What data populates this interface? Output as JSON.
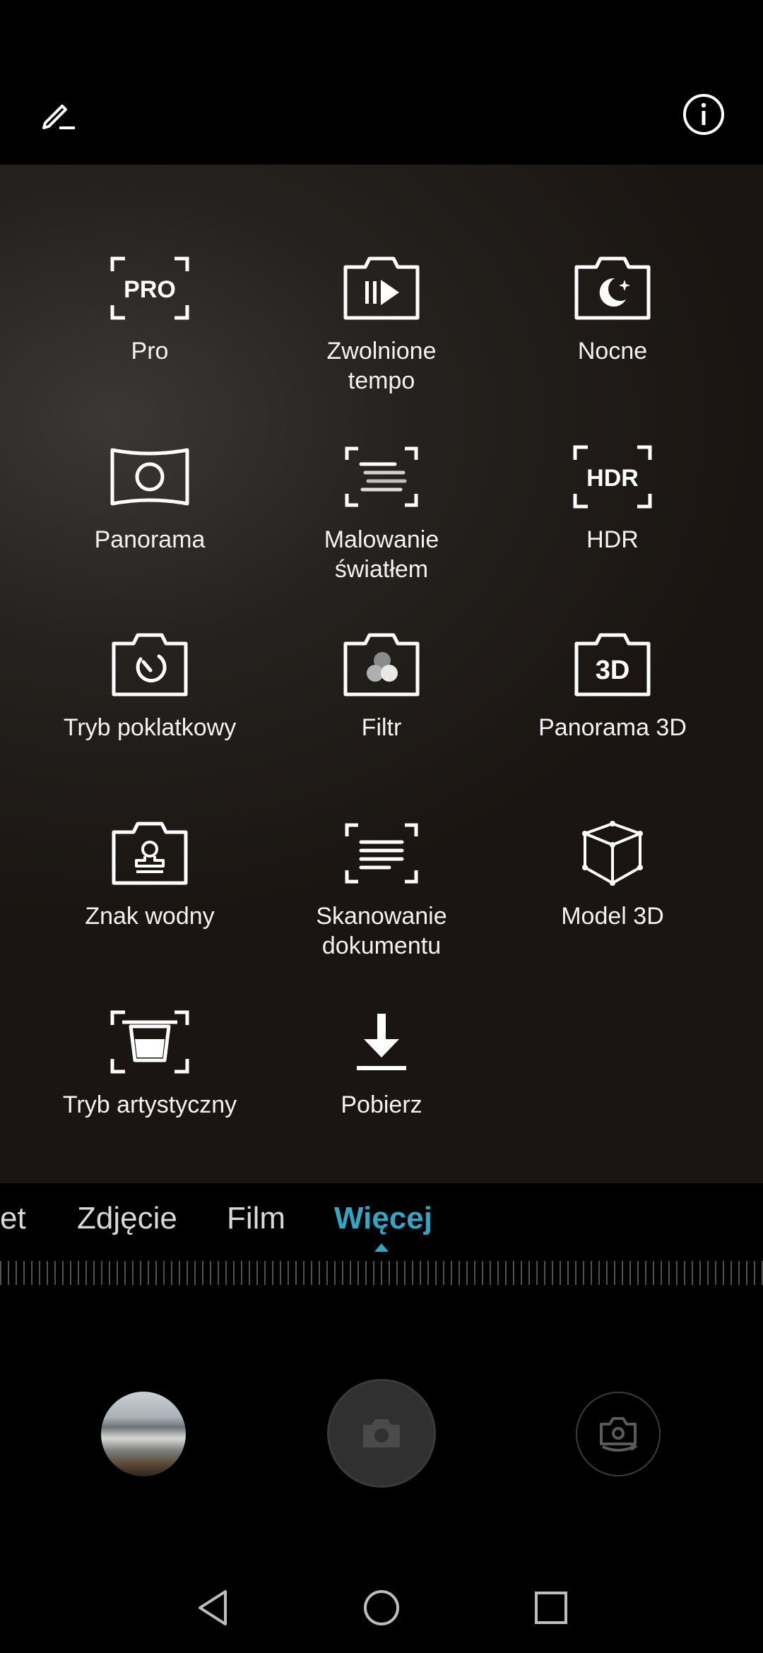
{
  "topbar": {
    "edit_icon": "pencil-edit-icon",
    "info_icon": "info-icon"
  },
  "modes": [
    {
      "label": "Pro",
      "icon": "pro-icon"
    },
    {
      "label": "Zwolnione\ntempo",
      "icon": "slow-motion-icon"
    },
    {
      "label": "Nocne",
      "icon": "night-icon"
    },
    {
      "label": "Panorama",
      "icon": "panorama-icon"
    },
    {
      "label": "Malowanie\nświatłem",
      "icon": "light-painting-icon"
    },
    {
      "label": "HDR",
      "icon": "hdr-icon"
    },
    {
      "label": "Tryb poklatkowy",
      "icon": "time-lapse-icon"
    },
    {
      "label": "Filtr",
      "icon": "filter-icon"
    },
    {
      "label": "Panorama 3D",
      "icon": "panorama-3d-icon"
    },
    {
      "label": "Znak wodny",
      "icon": "watermark-icon"
    },
    {
      "label": "Skanowanie\ndokumentu",
      "icon": "document-scan-icon"
    },
    {
      "label": "Model 3D",
      "icon": "3d-model-icon"
    },
    {
      "label": "Tryb artystyczny",
      "icon": "artistic-mode-icon"
    },
    {
      "label": "Pobierz",
      "icon": "download-icon"
    }
  ],
  "mode_strip": {
    "partial": "et",
    "photo": "Zdjęcie",
    "video": "Film",
    "more": "Więcej",
    "active_color": "#2fa7c6"
  },
  "controls": {
    "gallery_icon": "gallery-thumbnail",
    "shutter_icon": "camera-icon",
    "switch_icon": "switch-camera-icon"
  },
  "navbar": {
    "back_icon": "back-icon",
    "home_icon": "home-icon",
    "recents_icon": "recents-icon"
  }
}
